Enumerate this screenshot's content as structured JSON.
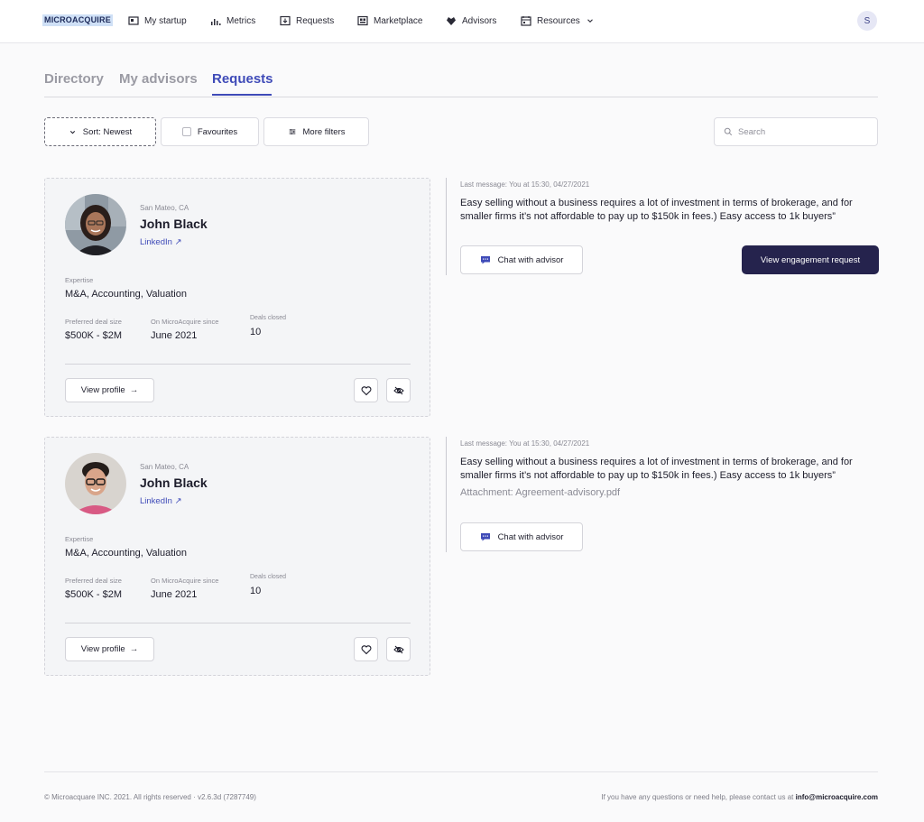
{
  "nav": {
    "logo": "MICROACQUIRE",
    "items": [
      {
        "label": "My startup",
        "icon": "startup-icon"
      },
      {
        "label": "Metrics",
        "icon": "metrics-icon"
      },
      {
        "label": "Requests",
        "icon": "requests-icon"
      },
      {
        "label": "Marketplace",
        "icon": "marketplace-icon"
      },
      {
        "label": "Advisors",
        "icon": "advisors-icon"
      },
      {
        "label": "Resources",
        "icon": "resources-icon"
      }
    ],
    "avatar_initial": "S"
  },
  "tabs": [
    {
      "label": "Directory",
      "active": false
    },
    {
      "label": "My advisors",
      "active": false
    },
    {
      "label": "Requests",
      "active": true
    }
  ],
  "filters": {
    "sort_label": "Sort: Newest",
    "favourites_label": "Favourites",
    "more_filters_label": "More filters",
    "search_placeholder": "Search"
  },
  "advisors": [
    {
      "location": "San Mateo, CA",
      "name": "John Black",
      "link_label": "LinkedIn",
      "expertise_label": "Expertise",
      "expertise": "M&A, Accounting, Valuation",
      "deal_size_label": "Preferred deal size",
      "deal_size": "$500K - $2M",
      "since_label": "On MicroAcquire since",
      "since": "June 2021",
      "deals_label": "Deals closed",
      "deals": "10",
      "view_profile_label": "View profile",
      "message": {
        "meta": "Last message: You at 15:30, 04/27/2021",
        "text": "Easy selling without a business requires a lot of investment in terms of brokerage, and for smaller firms it’s not affordable to pay up to $150k in fees.) Easy access to 1k buyers”",
        "attachment": "",
        "chat_label": "Chat with advisor",
        "engagement_label": "View engagement request"
      }
    },
    {
      "location": "San Mateo, CA",
      "name": "John Black",
      "link_label": "LinkedIn",
      "expertise_label": "Expertise",
      "expertise": "M&A, Accounting, Valuation",
      "deal_size_label": "Preferred deal size",
      "deal_size": "$500K - $2M",
      "since_label": "On MicroAcquire since",
      "since": "June 2021",
      "deals_label": "Deals closed",
      "deals": "10",
      "view_profile_label": "View profile",
      "message": {
        "meta": "Last message: You at 15:30, 04/27/2021",
        "text": "Easy selling without a business requires a lot of investment in terms of brokerage, and for smaller firms it’s not affordable to pay up to $150k in fees.) Easy access to 1k buyers”",
        "attachment": "Attachment: Agreement-advisory.pdf",
        "chat_label": "Chat with advisor",
        "engagement_label": ""
      }
    }
  ],
  "footer": {
    "copyright": "© Microacquare INC. 2021. All rights reserved  ·  v2.6.3d (7287749)",
    "help_text": "If you have any questions or need help, please contact us at",
    "email": "info@microacquire.com"
  },
  "colors": {
    "accent": "#3f4bb8",
    "primary_button": "#25234d",
    "card_bg": "#f4f5f7"
  }
}
